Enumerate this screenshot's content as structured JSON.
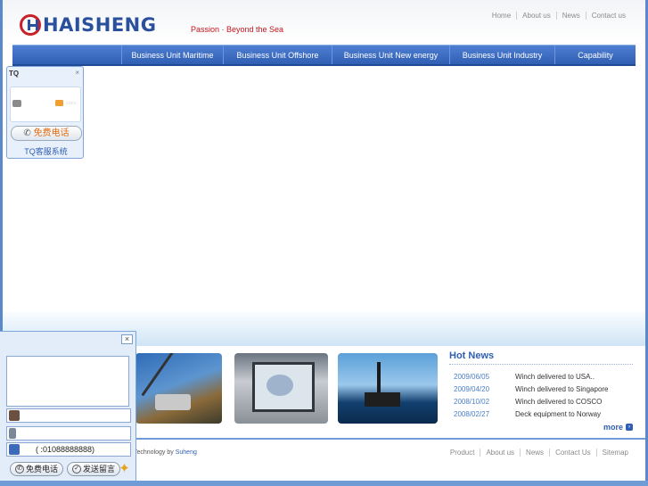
{
  "header": {
    "logo_text": "HAISHENG",
    "tagline": "Passion · Beyond the Sea",
    "top_links": [
      "Home",
      "About us",
      "News",
      "Contact us"
    ]
  },
  "nav": {
    "items": [
      "Business Unit Maritime",
      "Business Unit Offshore",
      "Business Unit New energy",
      "Business Unit Industry",
      "Capability"
    ]
  },
  "news": {
    "title": "Hot News",
    "items": [
      {
        "date": "2009/06/05",
        "title": "Winch delivered to USA.."
      },
      {
        "date": "2009/04/20",
        "title": "Winch delivered to Singapore"
      },
      {
        "date": "2008/10/02",
        "title": "Winch delivered to COSCO"
      },
      {
        "date": "2008/02/27",
        "title": "Deck equipment to Norway"
      }
    ],
    "more_label": "more"
  },
  "footer": {
    "credit_prefix": "Technology by",
    "credit_link": "Suheng",
    "links": [
      "Product",
      "About us",
      "News",
      "Contact Us",
      "Sitemap"
    ]
  },
  "tq_widget": {
    "title": "TQ",
    "close": "×",
    "call_label": "免费电话",
    "system_label": "TQ客服系统"
  },
  "chat_widget": {
    "close": "×",
    "phone_value": "( :01088888888)",
    "call_label": "免费电话",
    "send_label": "发送留言"
  },
  "colors": {
    "brand_blue": "#2a4f9c",
    "brand_red": "#c92027",
    "nav_blue": "#3a67bd"
  }
}
